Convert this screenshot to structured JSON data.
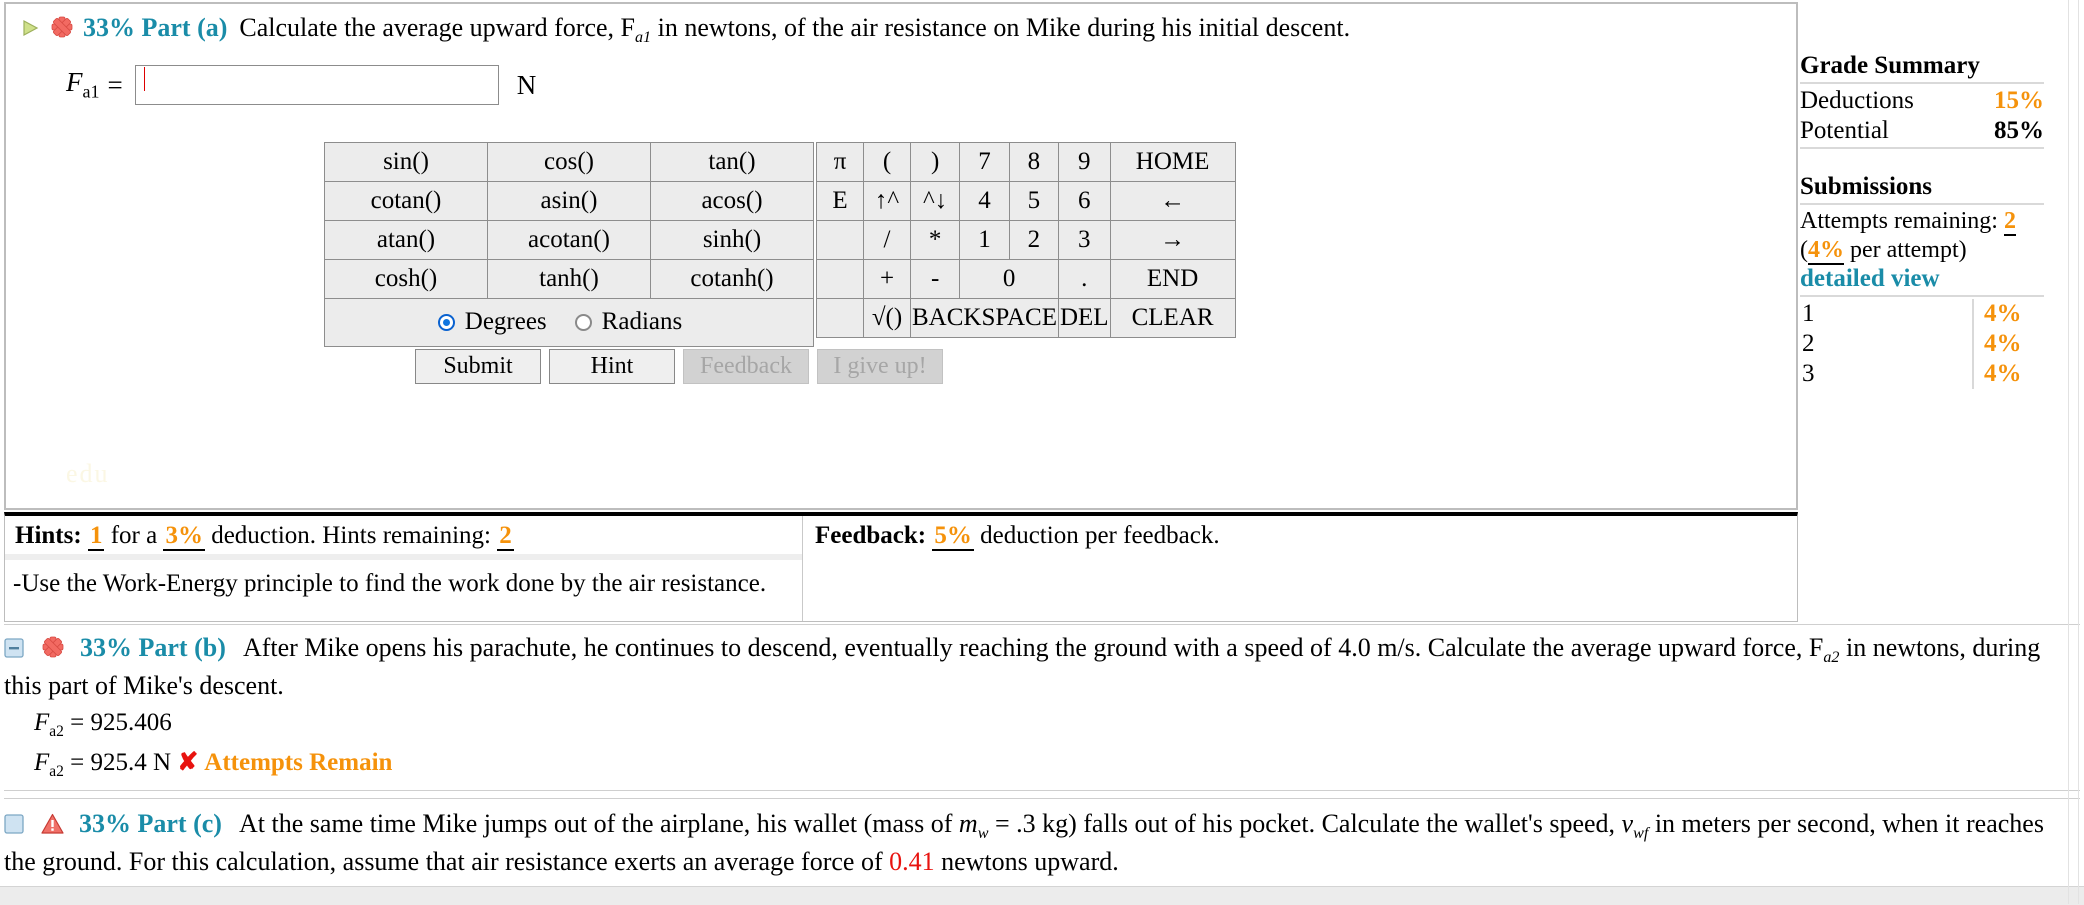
{
  "part_a": {
    "percent_label": "33% Part (a)",
    "icons": {
      "expand": "triangle-right-icon",
      "status": "red-star-icon"
    },
    "question": "Calculate the average upward force, F",
    "question_sub": "a1",
    "question_tail": " in newtons, of the air resistance on Mike during his initial descent.",
    "answer_var": "F",
    "answer_var_sub": "a1",
    "equals": "=",
    "input_value": "",
    "input_placeholder": "",
    "unit": "N"
  },
  "calculator": {
    "functions": [
      [
        "sin()",
        "cos()",
        "tan()"
      ],
      [
        "cotan()",
        "asin()",
        "acos()"
      ],
      [
        "atan()",
        "acotan()",
        "sinh()"
      ],
      [
        "cosh()",
        "tanh()",
        "cotanh()"
      ]
    ],
    "angle_mode": {
      "degrees": "Degrees",
      "radians": "Radians",
      "selected": "Degrees"
    },
    "keys": [
      [
        {
          "t": "π",
          "d": false
        },
        {
          "t": "(",
          "d": false
        },
        {
          "t": ")",
          "d": true
        },
        {
          "t": "7",
          "d": false
        },
        {
          "t": "8",
          "d": false
        },
        {
          "t": "9",
          "d": false
        },
        {
          "t": "HOME",
          "d": true
        }
      ],
      [
        {
          "t": "E",
          "d": false
        },
        {
          "t": "↑^",
          "d": true
        },
        {
          "t": "^↓",
          "d": true
        },
        {
          "t": "4",
          "d": false
        },
        {
          "t": "5",
          "d": false
        },
        {
          "t": "6",
          "d": false
        },
        {
          "t": "←",
          "d": true
        }
      ],
      [
        {
          "t": "",
          "d": false
        },
        {
          "t": "/",
          "d": true
        },
        {
          "t": "*",
          "d": true
        },
        {
          "t": "1",
          "d": false
        },
        {
          "t": "2",
          "d": false
        },
        {
          "t": "3",
          "d": false
        },
        {
          "t": "→",
          "d": true
        }
      ],
      [
        {
          "t": "",
          "d": false
        },
        {
          "t": "+",
          "d": false
        },
        {
          "t": "-",
          "d": false
        },
        {
          "t": "0",
          "d": false
        },
        {
          "t": ".",
          "d": false
        },
        {
          "t": "END",
          "d": true
        }
      ],
      [
        {
          "t": "",
          "d": false
        },
        {
          "t": "√()",
          "d": false
        },
        {
          "t": "BACKSPACE",
          "d": true
        },
        {
          "t": "DEL",
          "d": true
        },
        {
          "t": "CLEAR",
          "d": true
        }
      ]
    ]
  },
  "actions": {
    "submit": "Submit",
    "hint": "Hint",
    "feedback": "Feedback",
    "give_up": "I give up!"
  },
  "watermark": "edu",
  "hints": {
    "label": "Hints:",
    "count": "1",
    "for_a": "for a",
    "deduction_pct": "3%",
    "deduction_word": "deduction. Hints remaining:",
    "remaining": "2",
    "body": "-Use the Work-Energy principle to find the work done by the air resistance."
  },
  "feedback": {
    "label": "Feedback:",
    "pct": "5%",
    "text": "deduction per feedback."
  },
  "part_b": {
    "percent_label": "33% Part (b)",
    "text_1": "After Mike opens his parachute, he continues to descend, eventually reaching the ground with a speed of 4.0 m/s. Calculate the average upward force, F",
    "text_sub": "a2",
    "text_2": " in newtons, during this part of Mike's descent.",
    "result_var": "F",
    "result_sub": "a2",
    "result_raw": "= 925.406",
    "result_rounded": "= 925.4 N",
    "status_mark": "✘",
    "status_text": "Attempts Remain"
  },
  "part_c": {
    "percent_label": "33% Part (c)",
    "text_1": "At the same time Mike jumps out of the airplane, his wallet (mass of ",
    "mass_var": "m",
    "mass_sub": "w",
    "text_2": " = .3 kg) falls out of his pocket. Calculate the wallet's speed, ",
    "speed_var": "v",
    "speed_sub": "wf",
    "text_3": " in meters per second, when it reaches the ground. For this calculation, assume that air resistance exerts an average force of ",
    "force_value": "0.41",
    "text_4": " newtons upward."
  },
  "grade_summary": {
    "title": "Grade Summary",
    "rows": [
      {
        "label": "Deductions",
        "value": "15%",
        "style": "orange"
      },
      {
        "label": "Potential",
        "value": "85%",
        "style": "bold"
      }
    ],
    "submissions_title": "Submissions",
    "attempts_label": "Attempts remaining:",
    "attempts_value": "2",
    "per_attempt_open": "(",
    "per_attempt_pct": "4%",
    "per_attempt_close": " per attempt)",
    "detailed_view": "detailed view",
    "attempts_table": [
      {
        "n": "1",
        "pct": "4%"
      },
      {
        "n": "2",
        "pct": "4%"
      },
      {
        "n": "3",
        "pct": "4%"
      }
    ]
  },
  "colors": {
    "accent_teal": "#1a8ca8",
    "orange": "#f5920b",
    "red": "#e8130f"
  }
}
